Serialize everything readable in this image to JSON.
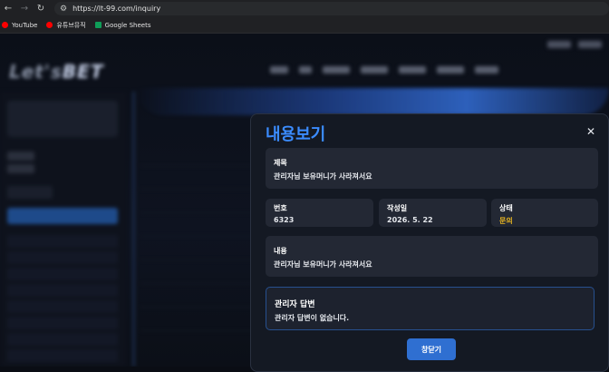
{
  "browser": {
    "url": "https://lt-99.com/inquiry",
    "bookmarks": [
      {
        "label": "YouTube",
        "icon": "youtube-icon",
        "color": "#ff0000"
      },
      {
        "label": "유튜브뮤직",
        "icon": "youtube-music-icon",
        "color": "#ff0000"
      },
      {
        "label": "Google Sheets",
        "icon": "google-sheets-icon",
        "color": "#0f9d58"
      }
    ]
  },
  "background_site": {
    "logo_prefix": "Let's",
    "logo_suffix": "BET"
  },
  "modal": {
    "title": "내용보기",
    "close_symbol": "✕",
    "subject": {
      "label": "제목",
      "value": "관리자님 보유머니가 사라져서요"
    },
    "number": {
      "label": "번호",
      "value": "6323"
    },
    "date": {
      "label": "작성일",
      "value": "2026. 5. 22"
    },
    "status": {
      "label": "상태",
      "value": "문의",
      "color": "#e6b422"
    },
    "content": {
      "label": "내용",
      "value": "관리자님 보유머니가 사라져서요"
    },
    "answer": {
      "label": "관리자 답변",
      "value": "관리자 답변이 없습니다."
    },
    "close_button_label": "창닫기"
  },
  "colors": {
    "accent": "#3b8cff",
    "button": "#2f6fd1",
    "modal_bg": "#141923",
    "box_bg": "#232834"
  }
}
